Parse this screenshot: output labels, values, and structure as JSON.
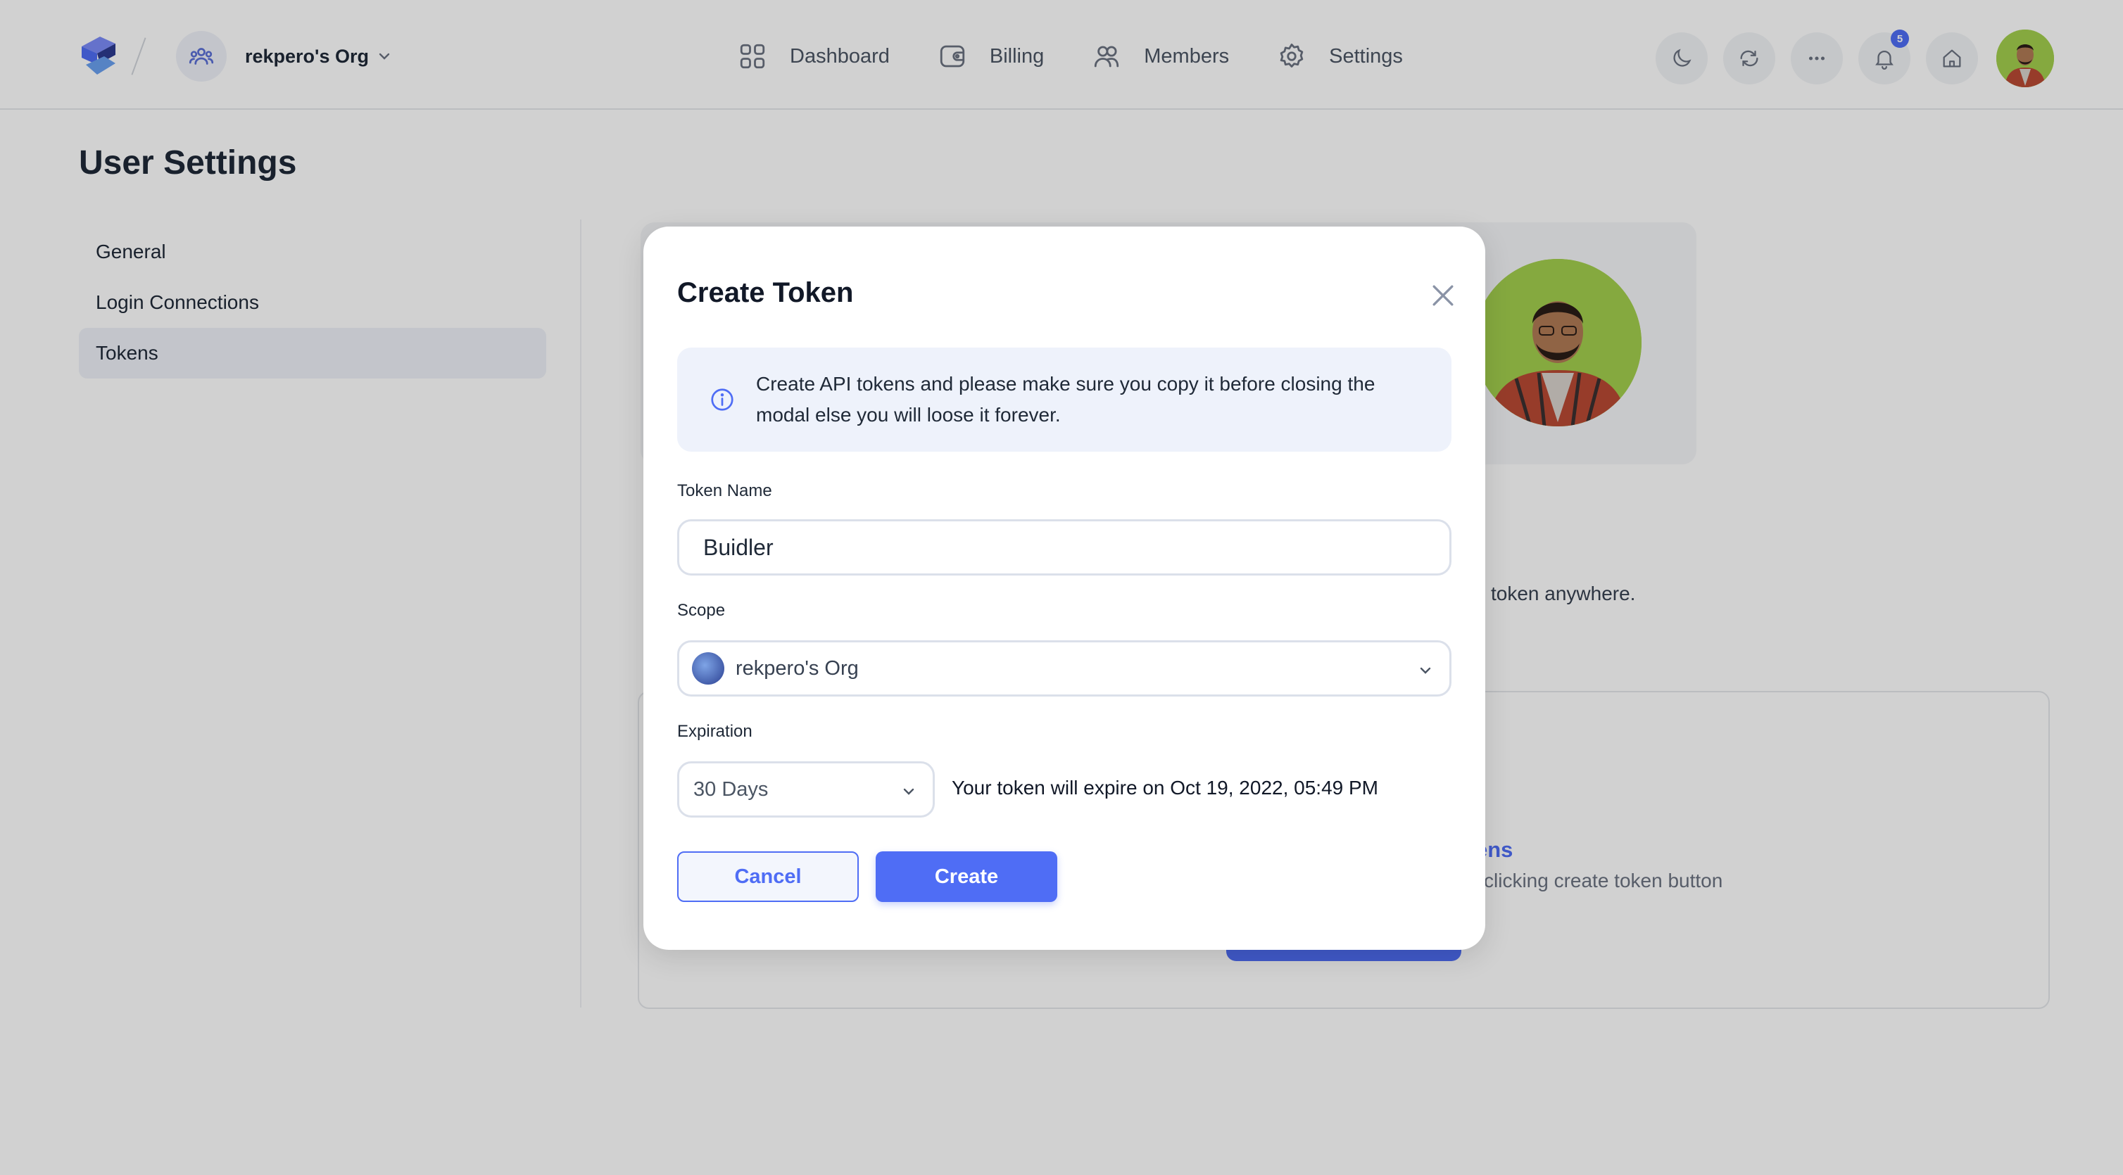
{
  "header": {
    "org_name": "rekpero's Org",
    "nav": [
      {
        "label": "Dashboard",
        "icon": "grid-icon"
      },
      {
        "label": "Billing",
        "icon": "wallet-icon"
      },
      {
        "label": "Members",
        "icon": "users-icon"
      },
      {
        "label": "Settings",
        "icon": "gear-icon"
      }
    ],
    "notification_count": "5"
  },
  "page": {
    "title": "User Settings"
  },
  "sidebar": {
    "items": [
      {
        "label": "General",
        "active": false
      },
      {
        "label": "Login Connections",
        "active": false
      },
      {
        "label": "Tokens",
        "active": true
      }
    ]
  },
  "background": {
    "hint_text": "token anywhere.",
    "empty_title": "ens",
    "empty_desc": "clicking create token button"
  },
  "modal": {
    "title": "Create Token",
    "info": "Create API tokens and please make sure you copy it before closing the modal else you will loose it forever.",
    "token_name_label": "Token Name",
    "token_name_value": "Buidler",
    "scope_label": "Scope",
    "scope_value": "rekpero's Org",
    "expiration_label": "Expiration",
    "expiration_value": "30 Days",
    "expire_note": "Your token will expire on Oct 19, 2022, 05:49 PM",
    "cancel_label": "Cancel",
    "create_label": "Create"
  },
  "colors": {
    "accent": "#4f6df5",
    "info_bg": "#eef2fb",
    "overlay": "rgba(0,0,0,0.18)"
  }
}
